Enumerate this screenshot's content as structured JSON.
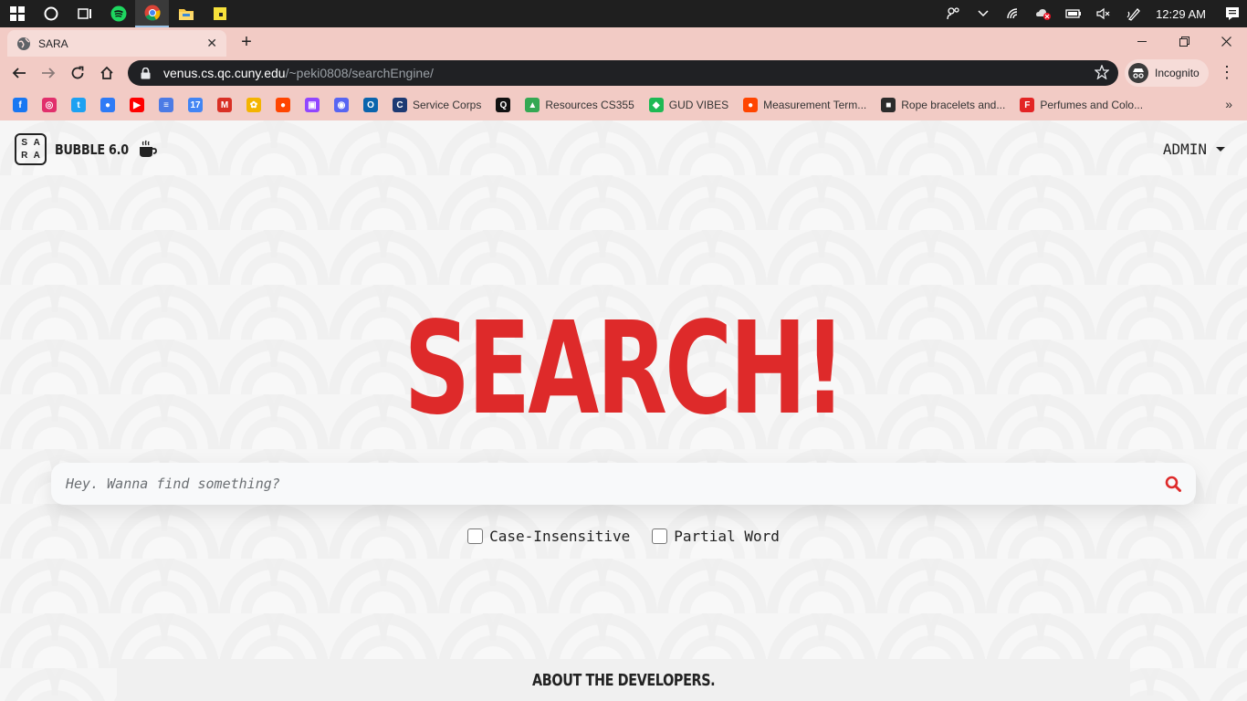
{
  "taskbar": {
    "apps": [
      "windows-start",
      "cortana",
      "task-view",
      "spotify",
      "chrome",
      "file-explorer",
      "sticky-notes"
    ],
    "clock": "12:29 AM"
  },
  "browser": {
    "tab_title": "SARA",
    "url_host": "venus.cs.qc.cuny.edu",
    "url_path": "/~peki0808/searchEngine/",
    "incognito_label": "Incognito",
    "bookmarks": [
      {
        "label": "",
        "icon": "facebook-icon",
        "color": "#1877f2",
        "glyph": "f"
      },
      {
        "label": "",
        "icon": "instagram-icon",
        "color": "#e1306c",
        "glyph": "◎"
      },
      {
        "label": "",
        "icon": "twitter-icon",
        "color": "#1da1f2",
        "glyph": "t"
      },
      {
        "label": "",
        "icon": "messenger-icon",
        "color": "#2e7bf6",
        "glyph": "●"
      },
      {
        "label": "",
        "icon": "youtube-icon",
        "color": "#ff0000",
        "glyph": "▶"
      },
      {
        "label": "",
        "icon": "google-forms-icon",
        "color": "#4c7be5",
        "glyph": "≡"
      },
      {
        "label": "",
        "icon": "google-calendar-icon",
        "color": "#4285f4",
        "glyph": "17"
      },
      {
        "label": "",
        "icon": "gmail-icon",
        "color": "#d93025",
        "glyph": "M"
      },
      {
        "label": "",
        "icon": "google-photos-icon",
        "color": "#f4b400",
        "glyph": "✿"
      },
      {
        "label": "",
        "icon": "reddit-icon",
        "color": "#ff4500",
        "glyph": "●"
      },
      {
        "label": "",
        "icon": "twitch-icon",
        "color": "#9146ff",
        "glyph": "▣"
      },
      {
        "label": "",
        "icon": "discord-icon",
        "color": "#5865f2",
        "glyph": "◉"
      },
      {
        "label": "",
        "icon": "outlook-icon",
        "color": "#0a64ad",
        "glyph": "O"
      },
      {
        "label": "Service Corps",
        "icon": "cuny-icon",
        "color": "#1d3a73",
        "glyph": "C"
      },
      {
        "label": "",
        "icon": "notion-icon",
        "color": "#111111",
        "glyph": "Q"
      },
      {
        "label": "Resources CS355",
        "icon": "google-drive-icon",
        "color": "#34a853",
        "glyph": "▲"
      },
      {
        "label": "GUD VIBES",
        "icon": "spotify-playlist-icon",
        "color": "#1db954",
        "glyph": "◆"
      },
      {
        "label": "Measurement Term...",
        "icon": "reddit-icon",
        "color": "#ff4500",
        "glyph": "●"
      },
      {
        "label": "Rope bracelets and...",
        "icon": "shop-icon",
        "color": "#2b2b2b",
        "glyph": "■"
      },
      {
        "label": "Perfumes and Colo...",
        "icon": "fragrance-icon",
        "color": "#e32424",
        "glyph": "F"
      }
    ]
  },
  "site": {
    "logo_letters": [
      "S",
      "A",
      "R",
      "A"
    ],
    "brand_name": "BUBBLE 6.0",
    "admin_label": "ADMIN",
    "hero_title": "SEARCH!",
    "search_placeholder": "Hey. Wanna find something?",
    "option_case": "Case-Insensitive",
    "option_partial": "Partial Word",
    "about_label": "ABOUT THE DEVELOPERS."
  },
  "colors": {
    "accent": "#de2a2a",
    "chrome_tab_bg": "#f2cbc5",
    "omnibox_bg": "#202124"
  }
}
